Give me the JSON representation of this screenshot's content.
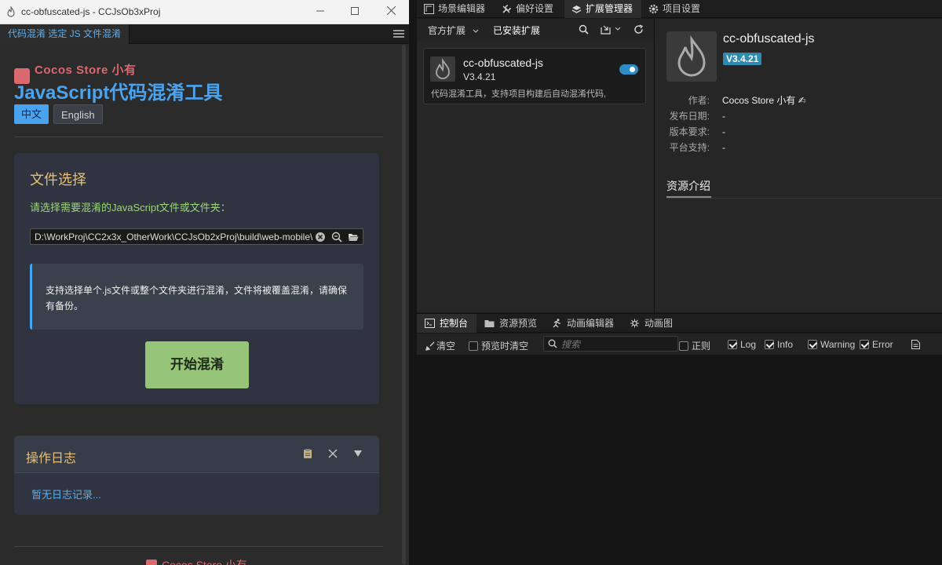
{
  "window": {
    "title": "cc-obfuscated-js - CCJsOb3xProj"
  },
  "panel": {
    "tab_label": "代码混淆 选定 JS 文件混淆",
    "brand": "Cocos Store 小有",
    "title": "JavaScript代码混淆工具",
    "lang_zh": "中文",
    "lang_en": "English",
    "file_section": {
      "title": "文件选择",
      "hint": "请选择需要混淆的JavaScript文件或文件夹：",
      "path": "D:\\WorkProj\\CC2x3x_OtherWork\\CCJsOb2xProj\\build\\web-mobile\\",
      "info": "支持选择单个.js文件或整个文件夹进行混淆，文件将被覆盖混淆，请确保有备份。",
      "start_button": "开始混淆"
    },
    "log_section": {
      "title": "操作日志",
      "empty_text": "暂无日志记录..."
    },
    "footer": "Cocos Store 小有"
  },
  "editor": {
    "top_tabs": [
      {
        "label": "场景编辑器",
        "icon": "scene-icon"
      },
      {
        "label": "偏好设置",
        "icon": "wrench-icon"
      },
      {
        "label": "扩展管理器",
        "icon": "extension-icon"
      },
      {
        "label": "项目设置",
        "icon": "gear-icon"
      }
    ],
    "ext_toolbar": {
      "official": "官方扩展",
      "installed": "已安装扩展"
    },
    "extension": {
      "name": "cc-obfuscated-js",
      "version": "V3.4.21",
      "desc": "代码混淆工具，支持项目构建后自动混淆代码,",
      "enabled": true
    },
    "detail": {
      "name": "cc-obfuscated-js",
      "version": "V3.4.21",
      "meta": [
        {
          "key": "作者:",
          "value": "Cocos Store 小有 ✍"
        },
        {
          "key": "发布日期:",
          "value": "-"
        },
        {
          "key": "版本要求:",
          "value": "-"
        },
        {
          "key": "平台支持:",
          "value": "-"
        }
      ],
      "intro_tab": "资源介绍"
    },
    "console_tabs": [
      {
        "label": "控制台",
        "icon": "console-icon"
      },
      {
        "label": "资源预览",
        "icon": "folder-icon"
      },
      {
        "label": "动画编辑器",
        "icon": "runner-icon"
      },
      {
        "label": "动画图",
        "icon": "graph-icon"
      }
    ],
    "console_toolbar": {
      "clear": "清空",
      "clear_on_preview": "预览时清空",
      "search_placeholder": "搜索",
      "regex": "正则",
      "log": "Log",
      "info": "Info",
      "warning": "Warning",
      "error": "Error"
    }
  },
  "colors": {
    "accent_blue": "#4aa3ee",
    "brand_red": "#d9686f",
    "section_gold": "#e8c077",
    "hint_green": "#9dd47d",
    "start_green": "#96c57a",
    "version_badge": "#2d8bb1"
  }
}
